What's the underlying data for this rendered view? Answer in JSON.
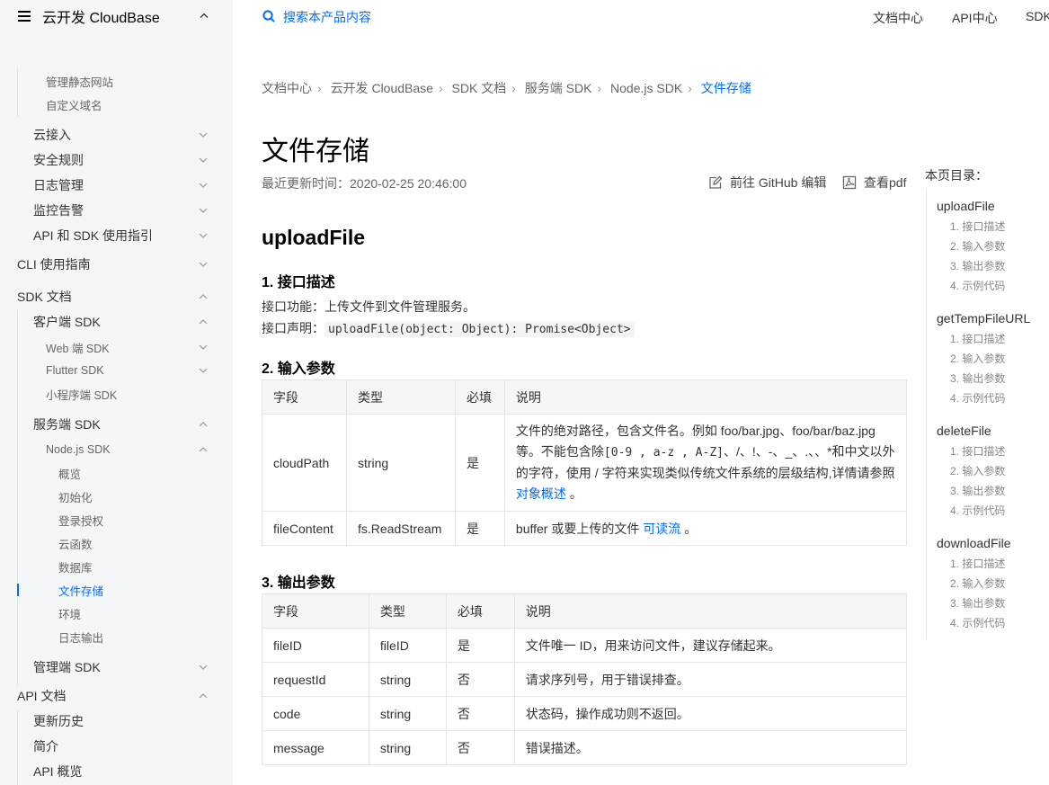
{
  "sidebar": {
    "product": "云开发 CloudBase",
    "items": [
      {
        "label": "管理静态网站",
        "level": 2,
        "chevron": "none"
      },
      {
        "label": "自定义域名",
        "level": 2,
        "chevron": "none"
      },
      {
        "label": "云接入",
        "level": 1,
        "chevron": "down"
      },
      {
        "label": "安全规则",
        "level": 1,
        "chevron": "down"
      },
      {
        "label": "日志管理",
        "level": 1,
        "chevron": "down"
      },
      {
        "label": "监控告警",
        "level": 1,
        "chevron": "down"
      },
      {
        "label": "API 和 SDK 使用指引",
        "level": 1,
        "chevron": "down"
      },
      {
        "label": "CLI 使用指南",
        "level": 0,
        "chevron": "down"
      },
      {
        "label": "SDK 文档",
        "level": 0,
        "chevron": "up"
      },
      {
        "label": "客户端 SDK",
        "level": 1,
        "chevron": "up"
      },
      {
        "label": "Web 端 SDK",
        "level": 2,
        "chevron": "down"
      },
      {
        "label": "Flutter SDK",
        "level": 2,
        "chevron": "down"
      },
      {
        "label": "小程序端 SDK",
        "level": 2,
        "chevron": "none"
      },
      {
        "label": "服务端 SDK",
        "level": 1,
        "chevron": "up"
      },
      {
        "label": "Node.js SDK",
        "level": 2,
        "chevron": "up"
      },
      {
        "label": "概览",
        "level": 3,
        "chevron": "none"
      },
      {
        "label": "初始化",
        "level": 3,
        "chevron": "none"
      },
      {
        "label": "登录授权",
        "level": 3,
        "chevron": "none"
      },
      {
        "label": "云函数",
        "level": 3,
        "chevron": "none"
      },
      {
        "label": "数据库",
        "level": 3,
        "chevron": "none"
      },
      {
        "label": "文件存储",
        "level": 3,
        "chevron": "none",
        "active": true
      },
      {
        "label": "环境",
        "level": 3,
        "chevron": "none"
      },
      {
        "label": "日志输出",
        "level": 3,
        "chevron": "none"
      },
      {
        "label": "管理端 SDK",
        "level": 1,
        "chevron": "down"
      },
      {
        "label": "API 文档",
        "level": 0,
        "chevron": "up"
      },
      {
        "label": "更新历史",
        "level": 1,
        "chevron": "none"
      },
      {
        "label": "简介",
        "level": 1,
        "chevron": "none"
      },
      {
        "label": "API 概览",
        "level": 1,
        "chevron": "none"
      }
    ]
  },
  "header": {
    "search_placeholder": "搜索本产品内容",
    "nav": [
      "文档中心",
      "API中心",
      "SDK"
    ]
  },
  "breadcrumb": [
    "文档中心",
    "云开发 CloudBase",
    "SDK 文档",
    "服务端 SDK",
    "Node.js SDK",
    "文件存储"
  ],
  "page": {
    "title": "文件存储",
    "updated": "最近更新时间：2020-02-25 20:46:00",
    "github_edit": "前往 GitHub 编辑",
    "view_pdf": "查看pdf"
  },
  "content": {
    "section_title": "uploadFile",
    "s1_title": "1. 接口描述",
    "s1_func": "接口功能：上传文件到文件管理服务。",
    "s1_decl_label": "接口声明：",
    "s1_decl_code": "uploadFile(object: Object): Promise<Object>",
    "s2_title": "2. 输入参数",
    "s3_title": "3. 输出参数",
    "headers": [
      "字段",
      "类型",
      "必填",
      "说明"
    ],
    "input_rows": [
      {
        "field": "cloudPath",
        "type": "string",
        "required": "是",
        "desc_1": "文件的绝对路径，包含文件名。例如 foo/bar.jpg、foo/bar/baz.jpg 等。不能包含除",
        "desc_code": "[0-9 , a-z , A-Z]",
        "desc_2": "、/、!、-、_、.、、*和中文以外的字符，使用 / 字符来实现类似传统文件系统的层级结构,详情请参照 ",
        "desc_link": "对象概述",
        "desc_3": " 。"
      },
      {
        "field": "fileContent",
        "type": "fs.ReadStream",
        "required": "是",
        "desc_1": "buffer 或要上传的文件 ",
        "desc_link": "可读流",
        "desc_3": " 。"
      }
    ],
    "output_rows": [
      {
        "field": "fileID",
        "type": "fileID",
        "required": "是",
        "desc": "文件唯一 ID，用来访问文件，建议存储起来。"
      },
      {
        "field": "requestId",
        "type": "string",
        "required": "否",
        "desc": "请求序列号，用于错误排查。"
      },
      {
        "field": "code",
        "type": "string",
        "required": "否",
        "desc": "状态码，操作成功则不返回。"
      },
      {
        "field": "message",
        "type": "string",
        "required": "否",
        "desc": "错误描述。"
      }
    ]
  },
  "toc": {
    "title": "本页目录：",
    "sections": [
      {
        "title": "uploadFile",
        "subs": [
          "1. 接口描述",
          "2. 输入参数",
          "3. 输出参数",
          "4. 示例代码"
        ]
      },
      {
        "title": "getTempFileURL",
        "subs": [
          "1. 接口描述",
          "2. 输入参数",
          "3. 输出参数",
          "4. 示例代码"
        ]
      },
      {
        "title": "deleteFile",
        "subs": [
          "1. 接口描述",
          "2. 输入参数",
          "3. 输出参数",
          "4. 示例代码"
        ]
      },
      {
        "title": "downloadFile",
        "subs": [
          "1. 接口描述",
          "2. 输入参数",
          "3. 输出参数",
          "4. 示例代码"
        ]
      }
    ]
  },
  "colors": {
    "accent": "#006eff",
    "sidebar_bg": "#f5f6f8"
  }
}
